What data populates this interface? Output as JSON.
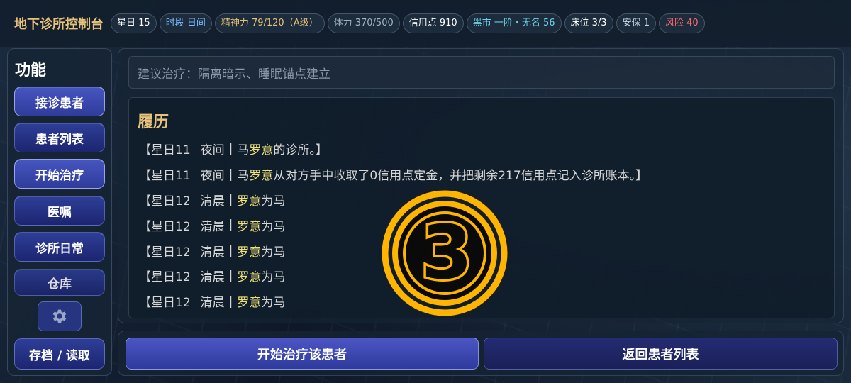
{
  "header": {
    "title": "地下诊所控制台",
    "chips": [
      {
        "label": "星日 15"
      },
      {
        "label": "时段 日间"
      },
      {
        "label": "精神力 79/120（A级）"
      },
      {
        "label": "体力 370/500"
      },
      {
        "label": "信用点 910"
      },
      {
        "label": "黑市 一阶・无名 56"
      },
      {
        "label": "床位 3/3"
      },
      {
        "label": "安保 1"
      },
      {
        "label": "风险 40"
      }
    ]
  },
  "sidebar": {
    "title": "功能",
    "items": [
      {
        "label": "接诊患者"
      },
      {
        "label": "患者列表"
      },
      {
        "label": "开始治疗"
      },
      {
        "label": "医嘱"
      },
      {
        "label": "诊所日常"
      },
      {
        "label": "仓库"
      }
    ],
    "settings_icon": "gear-icon",
    "save_label": "存档 / 读取"
  },
  "main": {
    "suggestion": "建议治疗：隔离暗示、睡眠锚点建立",
    "history": {
      "title": "履历",
      "entries": [
        {
          "prefix": "【星日11",
          "time": "夜间",
          "pre": "马",
          "name": "罗意",
          "post": "的诊所。】"
        },
        {
          "prefix": "【星日11",
          "time": "夜间",
          "pre": "马",
          "name": "罗意",
          "post": "从对方手中收取了0信用点定金，并把剩余217信用点记入诊所账本。】"
        },
        {
          "prefix": "【星日12",
          "time": "清晨",
          "pre": "",
          "name": "罗意",
          "post": "为马"
        },
        {
          "prefix": "【星日12",
          "time": "清晨",
          "pre": "",
          "name": "罗意",
          "post": "为马"
        },
        {
          "prefix": "【星日12",
          "time": "清晨",
          "pre": "",
          "name": "罗意",
          "post": "为马"
        },
        {
          "prefix": "【星日12",
          "time": "清晨",
          "pre": "",
          "name": "罗意",
          "post": "为马"
        },
        {
          "prefix": "【星日12",
          "time": "清晨",
          "pre": "",
          "name": "罗意",
          "post": "为马"
        }
      ]
    }
  },
  "actions": {
    "primary_label": "开始治疗该患者",
    "secondary_label": "返回患者列表"
  },
  "overlay": {
    "badge_icon": "number-3-badge-icon",
    "badge_text": "3"
  },
  "colors": {
    "accent_gold": "#e7c27a",
    "name_highlight": "#f0e27a",
    "risk_red": "#ff6a72",
    "market_cyan": "#6fd0e6",
    "badge_yellow": "#ffb400"
  }
}
